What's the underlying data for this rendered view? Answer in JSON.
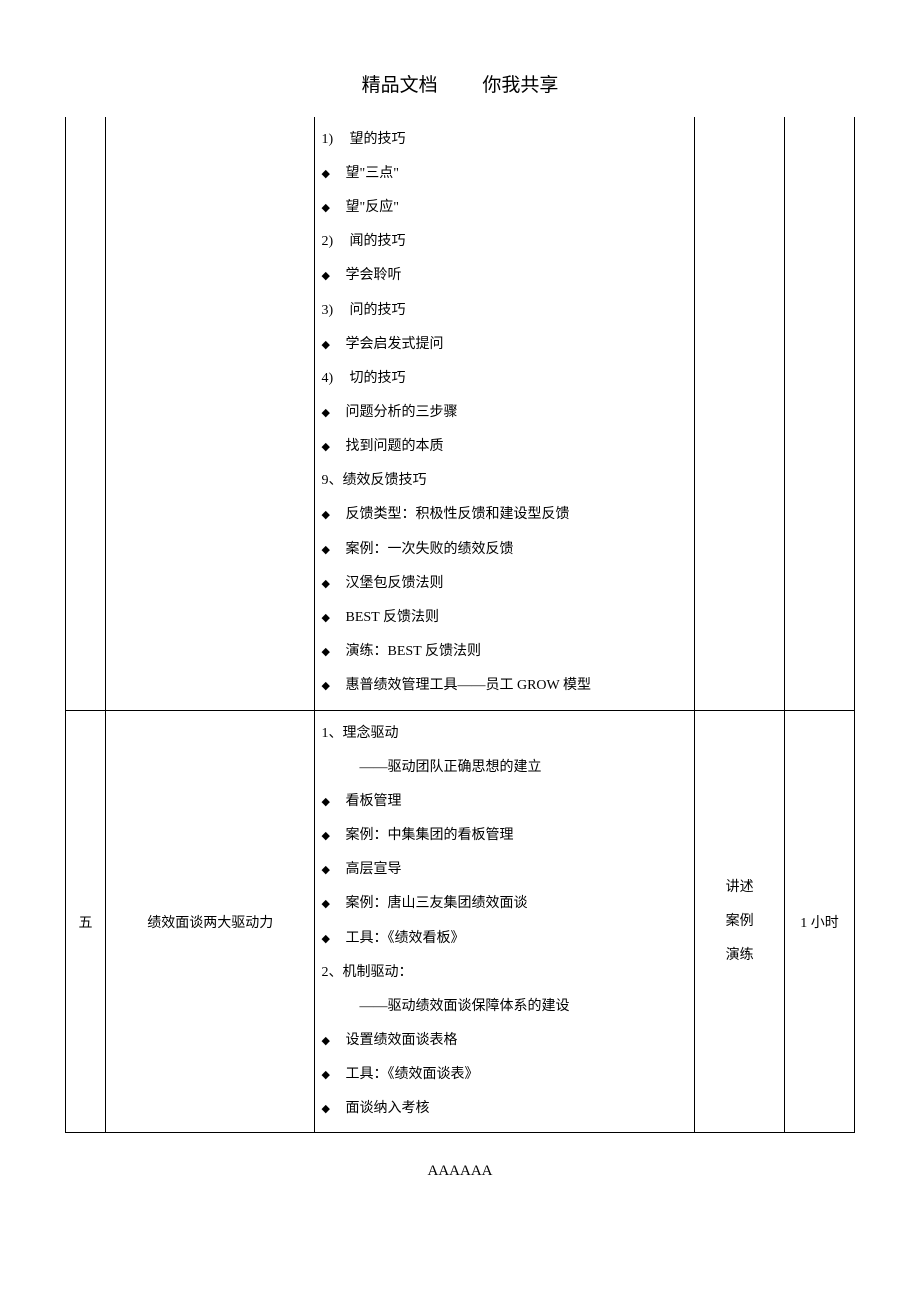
{
  "header": {
    "left": "精品文档",
    "right": "你我共享"
  },
  "footer": "AAAAAA",
  "rows": [
    {
      "idx": "",
      "topic": "",
      "method": [],
      "time": "",
      "content": [
        {
          "type": "num",
          "marker": "1)",
          "text": "望的技巧"
        },
        {
          "type": "bullet",
          "text": "望\"三点\""
        },
        {
          "type": "bullet",
          "text": "望\"反应\""
        },
        {
          "type": "num",
          "marker": "2)",
          "text": "闻的技巧"
        },
        {
          "type": "bullet",
          "text": "学会聆听"
        },
        {
          "type": "num",
          "marker": "3)",
          "text": "问的技巧"
        },
        {
          "type": "bullet",
          "text": "学会启发式提问"
        },
        {
          "type": "num",
          "marker": "4)",
          "text": "切的技巧"
        },
        {
          "type": "bullet",
          "text": "问题分析的三步骤"
        },
        {
          "type": "bullet",
          "text": "找到问题的本质"
        },
        {
          "type": "plain",
          "text": "9、绩效反馈技巧"
        },
        {
          "type": "bullet",
          "text": "反馈类型：积极性反馈和建设型反馈"
        },
        {
          "type": "bullet",
          "text": "案例：一次失败的绩效反馈"
        },
        {
          "type": "bullet",
          "text": "汉堡包反馈法则"
        },
        {
          "type": "bullet",
          "text": "BEST 反馈法则"
        },
        {
          "type": "bullet",
          "text": "演练：BEST 反馈法则"
        },
        {
          "type": "bullet",
          "text": "惠普绩效管理工具——员工 GROW 模型"
        }
      ]
    },
    {
      "idx": "五",
      "topic": "绩效面谈两大驱动力",
      "method": [
        "讲述",
        "案例",
        "演练"
      ],
      "time": "1 小时",
      "content": [
        {
          "type": "plain",
          "text": "1、理念驱动"
        },
        {
          "type": "sub",
          "text": "——驱动团队正确思想的建立"
        },
        {
          "type": "bullet",
          "text": "看板管理"
        },
        {
          "type": "bullet",
          "text": "案例：中集集团的看板管理"
        },
        {
          "type": "bullet",
          "text": "高层宣导"
        },
        {
          "type": "bullet",
          "text": "案例：唐山三友集团绩效面谈"
        },
        {
          "type": "bullet",
          "text": "工具：《绩效看板》"
        },
        {
          "type": "plain",
          "text": "2、机制驱动："
        },
        {
          "type": "sub",
          "text": "——驱动绩效面谈保障体系的建设"
        },
        {
          "type": "bullet",
          "text": "设置绩效面谈表格"
        },
        {
          "type": "bullet",
          "text": "工具：《绩效面谈表》"
        },
        {
          "type": "bullet",
          "text": "面谈纳入考核"
        }
      ]
    }
  ]
}
